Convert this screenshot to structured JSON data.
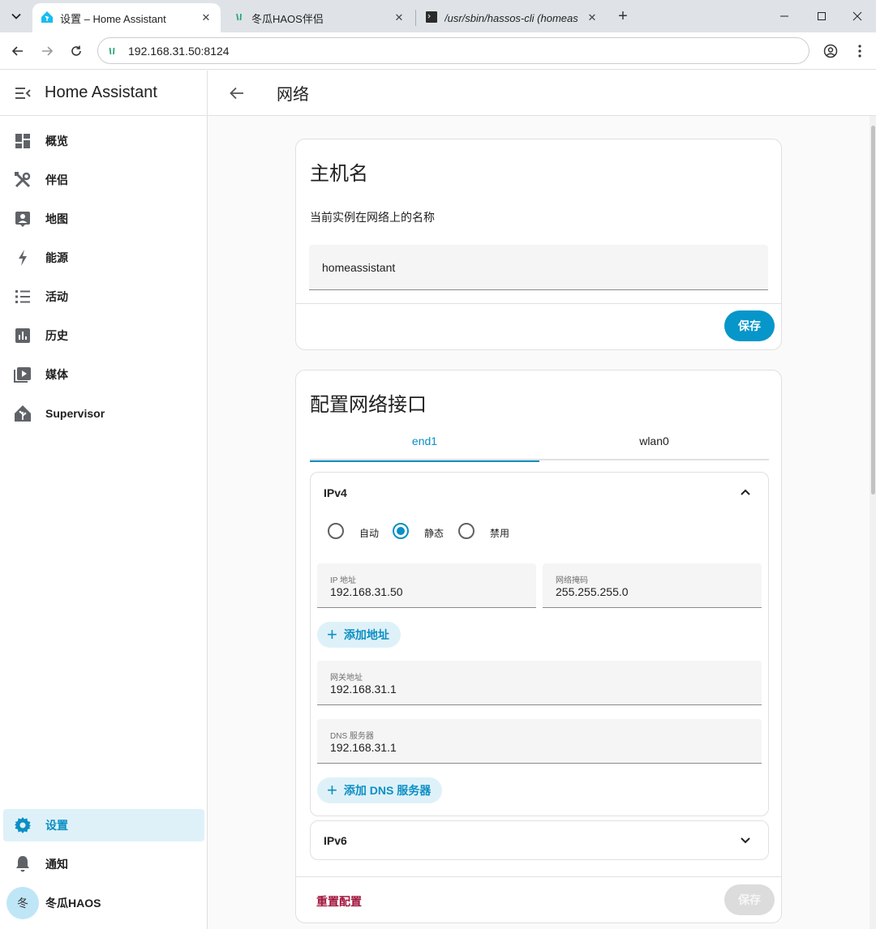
{
  "browser": {
    "tabs": [
      {
        "title": "设置 – Home Assistant",
        "active": true
      },
      {
        "title": "冬瓜HAOS伴侣",
        "active": false
      },
      {
        "title": "/usr/sbin/hassos-cli (homeas",
        "active": false
      }
    ],
    "url": "192.168.31.50:8124"
  },
  "sidebar": {
    "title": "Home Assistant",
    "items": [
      {
        "label": "概览",
        "icon": "dashboard-icon"
      },
      {
        "label": "伴侣",
        "icon": "tools-icon"
      },
      {
        "label": "地图",
        "icon": "map-account-icon"
      },
      {
        "label": "能源",
        "icon": "lightning-icon"
      },
      {
        "label": "活动",
        "icon": "list-icon"
      },
      {
        "label": "历史",
        "icon": "chart-box-icon"
      },
      {
        "label": "媒体",
        "icon": "media-icon"
      },
      {
        "label": "Supervisor",
        "icon": "home-assistant-icon"
      }
    ],
    "bottom": {
      "settings": "设置",
      "notifications": "通知",
      "user": "冬瓜HAOS",
      "user_initial": "冬"
    }
  },
  "header": {
    "title": "网络"
  },
  "hostname_card": {
    "title": "主机名",
    "description": "当前实例在网络上的名称",
    "value": "homeassistant",
    "save": "保存"
  },
  "network_card": {
    "title": "配置网络接口",
    "tabs": [
      "end1",
      "wlan0"
    ],
    "active_tab": "end1",
    "ipv4": {
      "title": "IPv4",
      "modes": [
        "自动",
        "静态",
        "禁用"
      ],
      "selected_mode": "静态",
      "ip_label": "IP 地址",
      "ip_value": "192.168.31.50",
      "mask_label": "网络掩码",
      "mask_value": "255.255.255.0",
      "add_address": "添加地址",
      "gateway_label": "网关地址",
      "gateway_value": "192.168.31.1",
      "dns_label": "DNS 服务器",
      "dns_value": "192.168.31.1",
      "add_dns": "添加 DNS 服务器"
    },
    "ipv6": {
      "title": "IPv6"
    },
    "reset": "重置配置",
    "save": "保存"
  },
  "colors": {
    "accent": "#0b8fc4",
    "reset": "#a1143c",
    "selected_bg": "#dff1f8"
  }
}
